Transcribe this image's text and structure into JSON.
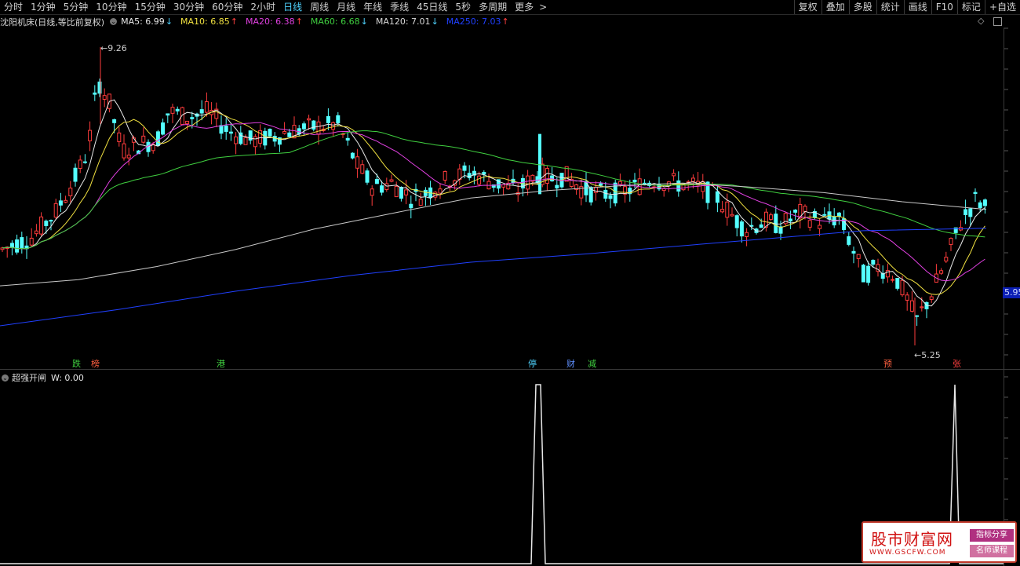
{
  "tabs": [
    "分时",
    "1分钟",
    "5分钟",
    "10分钟",
    "15分钟",
    "30分钟",
    "60分钟",
    "2小时",
    "日线",
    "周线",
    "月线",
    "年线",
    "季线",
    "45日线",
    "5秒",
    "多周期",
    "更多"
  ],
  "active_tab": "日线",
  "more_arrow": ">",
  "tools": [
    "复权",
    "叠加",
    "多股",
    "统计",
    "画线",
    "F10",
    "标记",
    "+自选"
  ],
  "legend": {
    "title": "沈阳机床(日线,等比前复权)",
    "ma": [
      {
        "label": "MA5: 6.99",
        "arrow": "↓",
        "color": "#e8e8e8"
      },
      {
        "label": "MA10: 6.85",
        "arrow": "↑",
        "color": "#f0e040"
      },
      {
        "label": "MA20: 6.38",
        "arrow": "↑",
        "color": "#e040e0"
      },
      {
        "label": "MA60: 6.68",
        "arrow": "↓",
        "color": "#40d040"
      },
      {
        "label": "MA120: 7.01",
        "arrow": "↓",
        "color": "#d8d8d8"
      },
      {
        "label": "MA250: 7.03",
        "arrow": "↑",
        "color": "#2040ff"
      }
    ]
  },
  "current_price_label": "5.95",
  "high_label": "9.26",
  "low_label": "5.25",
  "markers": [
    {
      "text": "跌",
      "color": "#40d040"
    },
    {
      "text": "榜",
      "color": "#ff6040"
    },
    {
      "text": "港",
      "color": "#40d040"
    },
    {
      "text": "停",
      "color": "#4fd3ff"
    },
    {
      "text": "财",
      "color": "#6090ff"
    },
    {
      "text": "减",
      "color": "#40d040"
    },
    {
      "text": "预",
      "color": "#ff6040"
    },
    {
      "text": "张",
      "color": "#ff4040"
    }
  ],
  "lower": {
    "title": "超强开闸",
    "value": "W: 0.00"
  },
  "watermark": {
    "main": "股市财富网",
    "url": "WWW.GSCFW.COM",
    "tag1": "指标分享",
    "tag2": "名师课程"
  },
  "colors": {
    "up": "#ff3c3c",
    "down": "#54ffff",
    "ma5": "#e8e8e8",
    "ma10": "#f0e040",
    "ma20": "#e040e0",
    "ma60": "#40d040",
    "ma120": "#c8c8c8",
    "ma250": "#2040ff"
  }
}
